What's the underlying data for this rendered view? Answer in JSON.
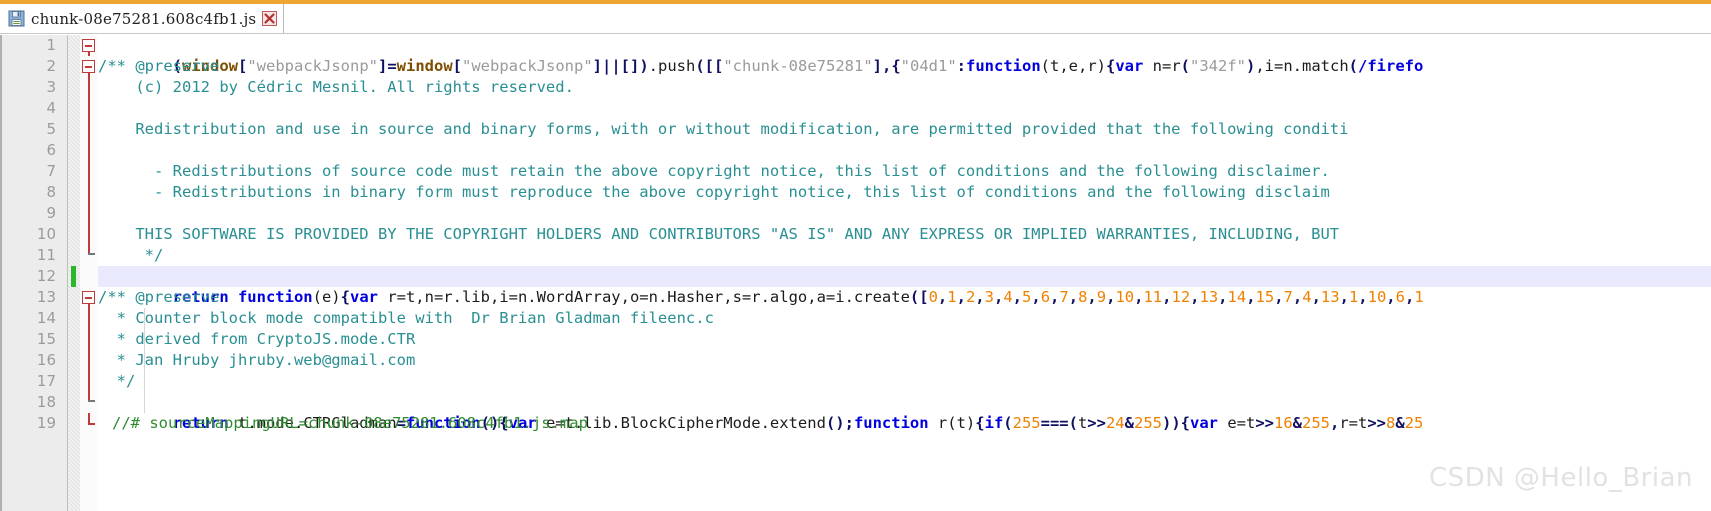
{
  "window": {
    "accent_color": "#eda534",
    "background": "#ffffff"
  },
  "tab": {
    "title": "chunk-08e75281.608c4fb1.js",
    "save_icon": "save-icon",
    "close_icon": "close-icon"
  },
  "editor": {
    "gutter_background": "#ececec",
    "line_number_color": "#9b9b9b",
    "highlighted_line": 12,
    "highlight_color": "#eaeaff",
    "change_marker_color": "#2bb62b",
    "fold_marker_color": "#c03a3a",
    "line_numbers": [
      1,
      2,
      3,
      4,
      5,
      6,
      7,
      8,
      9,
      10,
      11,
      12,
      13,
      14,
      15,
      16,
      17,
      18,
      19
    ],
    "total_lines_visible": 19
  },
  "syntax_colors": {
    "keyword": "#0000e0",
    "identifier_bold": "#7d4e00",
    "string": "#9a9a9a",
    "punctuation": "#101060",
    "number": "#f08000",
    "block_comment": "#2a8f93",
    "line_comment": "#2e8b2e",
    "plain": "#1c1c1c"
  },
  "code": {
    "line1": "(window[\"webpackJsonp\"]=window[\"webpackJsonp\"]||[]).push([[\"chunk-08e75281\"],{\"04d1\":function(t,e,r){var n=r(\"342f\"),i=n.match(/firefo",
    "line2": "/** @preserve",
    "line3": "    (c) 2012 by Cédric Mesnil. All rights reserved.",
    "line4": "",
    "line5": "    Redistribution and use in source and binary forms, with or without modification, are permitted provided that the following conditi",
    "line6": "",
    "line7": "      - Redistributions of source code must retain the above copyright notice, this list of conditions and the following disclaimer.",
    "line8": "      - Redistributions in binary form must reproduce the above copyright notice, this list of conditions and the following disclaim",
    "line9": "",
    "line10": "    THIS SOFTWARE IS PROVIDED BY THE COPYRIGHT HOLDERS AND CONTRIBUTORS \"AS IS\" AND ANY EXPRESS OR IMPLIED WARRANTIES, INCLUDING, BUT",
    "line11": "     */",
    "line12": "return function(e){var r=t,n=r.lib,i=n.WordArray,o=n.Hasher,s=r.algo,a=i.create([0,1,2,3,4,5,6,7,8,9,10,11,12,13,14,15,7,4,13,1,10,6,1",
    "line13": "/** @preserve",
    "line14": "  * Counter block mode compatible with  Dr Brian Gladman fileenc.c",
    "line15": "  * derived from CryptoJS.mode.CTR",
    "line16": "  * Jan Hruby jhruby.web@gmail.com",
    "line17": "  */",
    "line18": "return t.mode.CTRGladman=function(){var e=t.lib.BlockCipherMode.extend();function r(t){if(255===(t>>24&255)){var e=t>>16&255,r=t>>8&25",
    "line19": "//# sourceMappingURL=chunk-08e75281.608c4fb1.js.map"
  },
  "watermark": {
    "text": "CSDN @Hello_Brian"
  }
}
